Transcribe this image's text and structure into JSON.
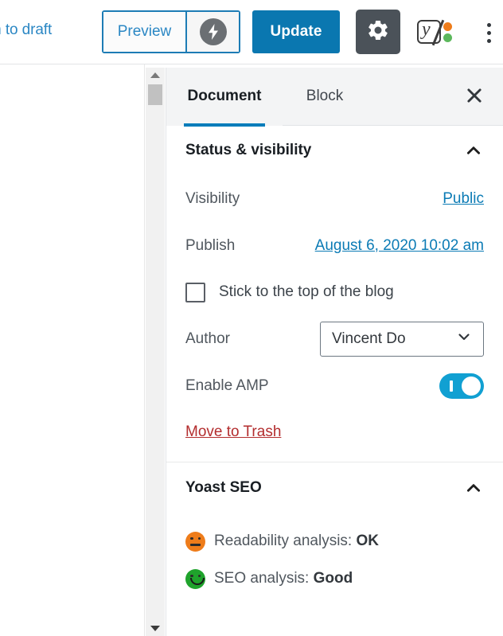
{
  "toolbar": {
    "switch_to_draft_label": "th to draft",
    "preview_label": "Preview",
    "amp_preview_icon": "amp-lightning-icon",
    "update_label": "Update",
    "settings_icon": "gear-icon",
    "yoast_icon": "yoast-logo-icon",
    "more_options_icon": "kebab-menu-icon",
    "colors": {
      "update_bg": "#0a77b0",
      "preview_border": "#1d7cb5",
      "gear_bg": "#4b5259",
      "yoast_orange": "#ee7c1a",
      "yoast_green": "#5cb85c"
    }
  },
  "sidebar": {
    "tabs": [
      {
        "label": "Document",
        "active": true
      },
      {
        "label": "Block",
        "active": false
      }
    ],
    "close_icon": "close-icon",
    "panels": [
      {
        "title": "Status & visibility",
        "collapse_icon": "chevron-up-icon",
        "rows": {
          "visibility_label": "Visibility",
          "visibility_value": "Public",
          "publish_label": "Publish",
          "publish_value": "August 6, 2020 10:02 am",
          "sticky_label": "Stick to the top of the blog",
          "sticky_checked": false,
          "author_label": "Author",
          "author_value": "Vincent Do",
          "amp_label": "Enable AMP",
          "amp_enabled": true,
          "trash_label": "Move to Trash"
        }
      },
      {
        "title": "Yoast SEO",
        "collapse_icon": "chevron-up-icon",
        "analysis": [
          {
            "icon": "neutral-face-icon",
            "color": "#ee7c1a",
            "label": "Readability analysis:",
            "value": "OK"
          },
          {
            "icon": "smiley-face-icon",
            "color": "#1fa32c",
            "label": "SEO analysis:",
            "value": "Good"
          }
        ]
      }
    ]
  },
  "scrollbar": {
    "up_icon": "triangle-up-icon",
    "down_icon": "triangle-down-icon"
  }
}
